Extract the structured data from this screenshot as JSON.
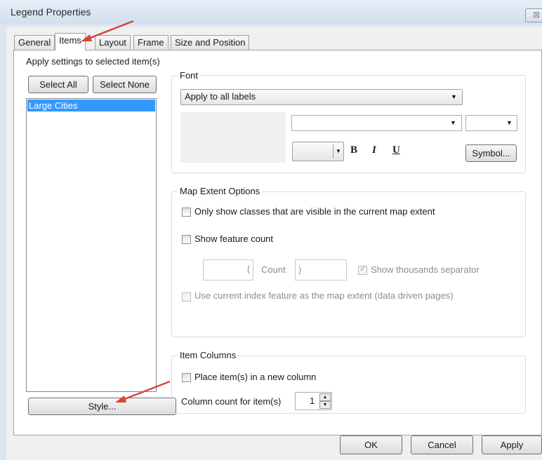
{
  "window": {
    "title": "Legend Properties",
    "close_glyph": "☒"
  },
  "tabs": [
    {
      "label": "General",
      "active": false
    },
    {
      "label": "Items",
      "active": true
    },
    {
      "label": "Layout",
      "active": false
    },
    {
      "label": "Frame",
      "active": false
    },
    {
      "label": "Size and Position",
      "active": false
    }
  ],
  "items_panel": {
    "heading": "Apply settings to selected item(s)",
    "select_all_label": "Select All",
    "select_none_label": "Select None",
    "list_items": [
      "Large Cities"
    ],
    "style_button_label": "Style..."
  },
  "font_group": {
    "label": "Font",
    "apply_to_value": "Apply to all labels",
    "font_name_value": "",
    "font_size_value": "",
    "bold_label": "B",
    "italic_label": "I",
    "underline_label": "U",
    "symbol_button_label": "Symbol..."
  },
  "map_extent_group": {
    "label": "Map Extent Options",
    "only_visible_label": "Only show classes that are visible in the current map extent",
    "only_visible_checked": false,
    "show_count_label": "Show feature count",
    "show_count_checked": false,
    "prefix_value": "",
    "open_paren": "(",
    "count_label": "Count",
    "close_paren": ")",
    "suffix_value": "",
    "thousands_label": "Show thousands separator",
    "thousands_checked": true,
    "index_feature_label": "Use current index feature as the map extent (data driven pages)",
    "index_feature_checked": false
  },
  "item_columns_group": {
    "label": "Item Columns",
    "new_column_label": "Place item(s) in a new column",
    "new_column_checked": false,
    "column_count_label": "Column count for item(s)",
    "column_count_value": "1"
  },
  "footer": {
    "ok_label": "OK",
    "cancel_label": "Cancel",
    "apply_label": "Apply"
  },
  "colors": {
    "selection": "#3399ff",
    "annotation_arrow": "#d9443b"
  }
}
